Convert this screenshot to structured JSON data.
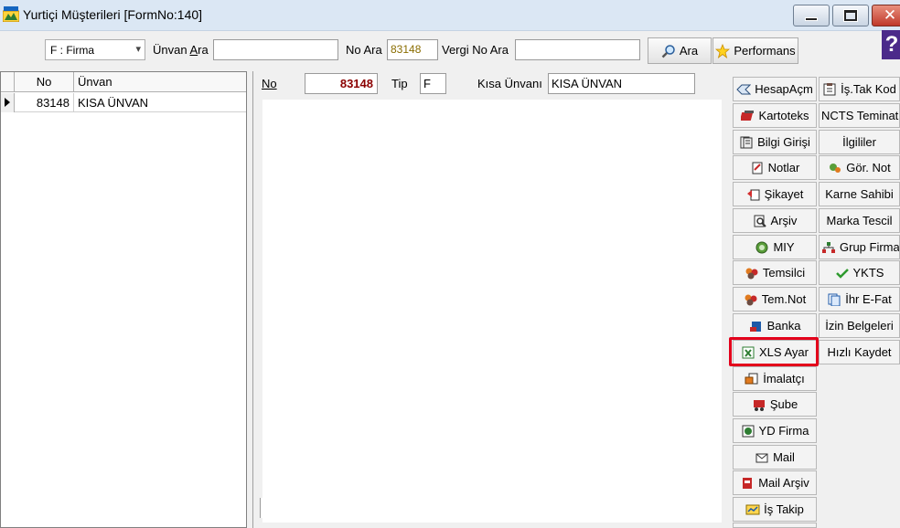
{
  "window": {
    "title": "Yurtiçi Müşterileri [FormNo:140]"
  },
  "toolbar": {
    "filter_select_value": "F : Firma",
    "unvan_ara_label_pre": "Ünvan ",
    "unvan_ara_label_u": "A",
    "unvan_ara_label_post": "ra",
    "unvan_ara_value": "",
    "no_ara_label": "No Ara",
    "no_ara_value": "83148",
    "vergi_no_ara_label": "Vergi No Ara",
    "vergi_no_ara_value": "",
    "ara_button": "Ara",
    "performans_button": "Performans",
    "help_glyph": "?"
  },
  "grid": {
    "columns": [
      "No",
      "Ünvan"
    ],
    "rows": [
      {
        "no": "83148",
        "unvan": "KISA ÜNVAN"
      }
    ]
  },
  "detail": {
    "no_label": "No",
    "no_value": "83148",
    "tip_label": "Tip",
    "tip_value": "F",
    "kisa_unvan_label": "Kısa Ünvanı",
    "kisa_unvan_value": "KISA ÜNVAN"
  },
  "right_buttons_col1": [
    {
      "label": "HesapAçm",
      "icon": "hesap-icon"
    },
    {
      "label": "Kartoteks",
      "icon": "kartoteks-icon"
    },
    {
      "label": "Bilgi Girişi",
      "icon": "bilgi-icon"
    },
    {
      "label": "Notlar",
      "icon": "notlar-icon"
    },
    {
      "label": "Şikayet",
      "icon": "sikayet-icon"
    },
    {
      "label": "Arşiv",
      "icon": "arsiv-icon"
    },
    {
      "label": "MIY",
      "icon": "miy-icon"
    },
    {
      "label": "Temsilci",
      "icon": "temsilci-icon"
    },
    {
      "label": "Tem.Not",
      "icon": "temnot-icon"
    },
    {
      "label": "Banka",
      "icon": "banka-icon"
    },
    {
      "label": "XLS Ayar",
      "icon": "xls-icon"
    },
    {
      "label": "İmalatçı",
      "icon": "imalatci-icon"
    },
    {
      "label": "Şube",
      "icon": "sube-icon"
    },
    {
      "label": "YD Firma",
      "icon": "ydfirma-icon"
    },
    {
      "label": "Mail",
      "icon": "mail-icon"
    },
    {
      "label": "Mail Arşiv",
      "icon": "mailarsiv-icon"
    },
    {
      "label": "İş Takip",
      "icon": "istakip-icon"
    }
  ],
  "right_buttons_col2": [
    {
      "label": "İş.Tak Kod",
      "icon": "istak-icon"
    },
    {
      "label": "NCTS Teminat",
      "icon": ""
    },
    {
      "label": "İlgililer",
      "icon": ""
    },
    {
      "label": "Gör. Not",
      "icon": "gornot-icon"
    },
    {
      "label": "Karne Sahibi",
      "icon": ""
    },
    {
      "label": "Marka Tescil",
      "icon": ""
    },
    {
      "label": "Grup Firma",
      "icon": "grupfirma-icon"
    },
    {
      "label": "YKTS",
      "icon": "check-icon"
    },
    {
      "label": "İhr E-Fat",
      "icon": "efat-icon"
    },
    {
      "label": "İzin Belgeleri",
      "icon": ""
    },
    {
      "label": "Hızlı Kaydet",
      "icon": ""
    }
  ],
  "colors": {
    "highlight": "#e3001b",
    "no_value": "#8b0000",
    "titlebar": "#dbe7f4"
  }
}
